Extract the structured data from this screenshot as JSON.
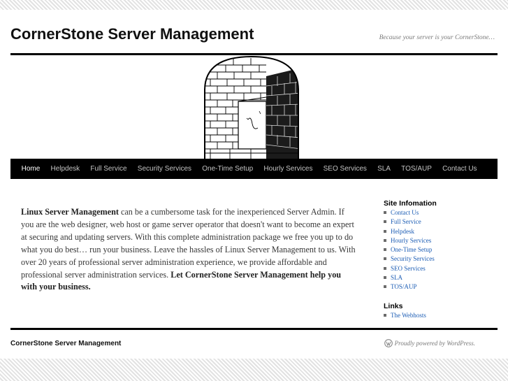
{
  "header": {
    "site_title": "CornerStone Server Management",
    "site_description": "Because your server is your CornerStone…"
  },
  "nav": {
    "items": [
      "Home",
      "Helpdesk",
      "Full Service",
      "Security Services",
      "One-Time Setup",
      "Hourly Services",
      "SEO Services",
      "SLA",
      "TOS/AUP",
      "Contact Us"
    ],
    "current": "Home"
  },
  "content": {
    "bold_lead": "Linux Server Management",
    "body": " can be a cumbersome task for the inexperienced Server Admin. If you are the web designer, web host or game server operator that doesn't want to become an expert at securing and updating servers.  With this complete administration package we free you up to do what you do best… run your business. Leave the hassles of Linux Server Management to us. With over 20 years of professional server administration experience, we provide affordable and professional server administration services.  ",
    "bold_close": "Let CornerStone Server Management help you with your business."
  },
  "sidebar": {
    "info_title": "Site Infomation",
    "info_items": [
      "Contact Us",
      "Full Service",
      "Helpdesk",
      "Hourly Services",
      "One-Time Setup",
      "Security Services",
      "SEO Services",
      "SLA",
      "TOS/AUP"
    ],
    "links_title": "Links",
    "links_items": [
      "The Webhosts"
    ]
  },
  "footer": {
    "site": "CornerStone Server Management",
    "credit": "Proudly powered by WordPress."
  },
  "icons": {
    "header_image": "brick-archway-doorway-illustration",
    "credit_icon": "wordpress-logo-icon"
  },
  "colors": {
    "link": "#1b5cb4",
    "nav_bg": "#000000",
    "accent_rules": "#000000"
  }
}
